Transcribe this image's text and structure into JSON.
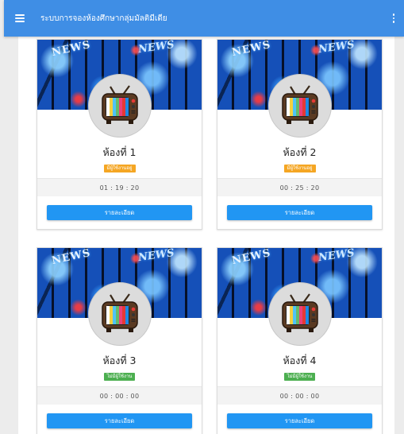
{
  "appbar": {
    "title": "ระบบการจองห้องศึกษากลุ่มมัลติมีเดีย",
    "color": "#3f8ee5"
  },
  "icons": {
    "menu": "hamburger-menu-icon",
    "more": "more-vert-icon",
    "room": "tv-icon"
  },
  "rooms": [
    {
      "name": "ห้องที่ 1",
      "status": "มีผู้ใช้งานอยู่",
      "status_color": "#f5a623",
      "timer": "01 : 19 : 20",
      "button": "รายละเอียด"
    },
    {
      "name": "ห้องที่ 2",
      "status": "มีผู้ใช้งานอยู่",
      "status_color": "#f5a623",
      "timer": "00 : 25 : 20",
      "button": "รายละเอียด"
    },
    {
      "name": "ห้องที่ 3",
      "status": "ไม่มีผู้ใช้งาน",
      "status_color": "#4caf50",
      "timer": "00 : 00 : 00",
      "button": "รายละเอียด"
    },
    {
      "name": "ห้องที่ 4",
      "status": "ไม่มีผู้ใช้งาน",
      "status_color": "#4caf50",
      "timer": "00 : 00 : 00",
      "button": "รายละเอียด"
    }
  ],
  "button_color": "#2196f3"
}
